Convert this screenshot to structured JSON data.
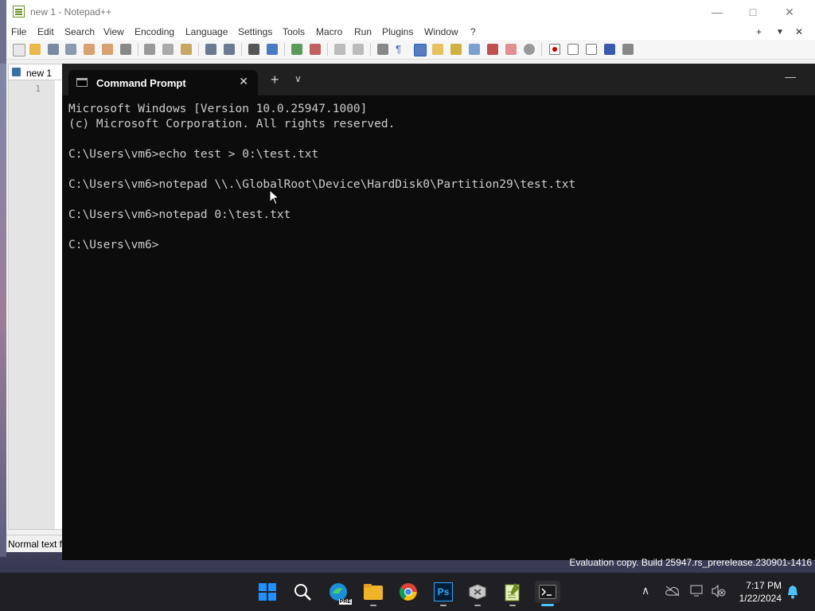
{
  "notepad": {
    "title": "new 1 - Notepad++",
    "menu": [
      "File",
      "Edit",
      "Search",
      "View",
      "Encoding",
      "Language",
      "Settings",
      "Tools",
      "Macro",
      "Run",
      "Plugins",
      "Window",
      "?"
    ],
    "tab_label": "new 1",
    "line_number": "1",
    "status": "Normal text f",
    "menu_right": [
      "+",
      "▼",
      "✕"
    ]
  },
  "terminal": {
    "tab_title": "Command Prompt",
    "lines": [
      "Microsoft Windows [Version 10.0.25947.1000]",
      "(c) Microsoft Corporation. All rights reserved.",
      "",
      "C:\\Users\\vm6>echo test > 0:\\test.txt",
      "",
      "C:\\Users\\vm6>notepad \\\\.\\GlobalRoot\\Device\\HardDisk0\\Partition29\\test.txt",
      "",
      "C:\\Users\\vm6>notepad 0:\\test.txt",
      "",
      "C:\\Users\\vm6>"
    ]
  },
  "watermark": "Evaluation copy. Build 25947.rs_prerelease.230901-1416",
  "taskbar": {
    "time": "7:17 PM",
    "date": "1/22/2024",
    "apps": [
      "start-icon",
      "search-icon",
      "edge-icon",
      "file-explorer-icon",
      "chrome-icon",
      "photoshop-icon",
      "app-icon",
      "notepadpp-icon",
      "terminal-icon"
    ],
    "ps_label": "Ps",
    "pre_label": "PRE"
  }
}
